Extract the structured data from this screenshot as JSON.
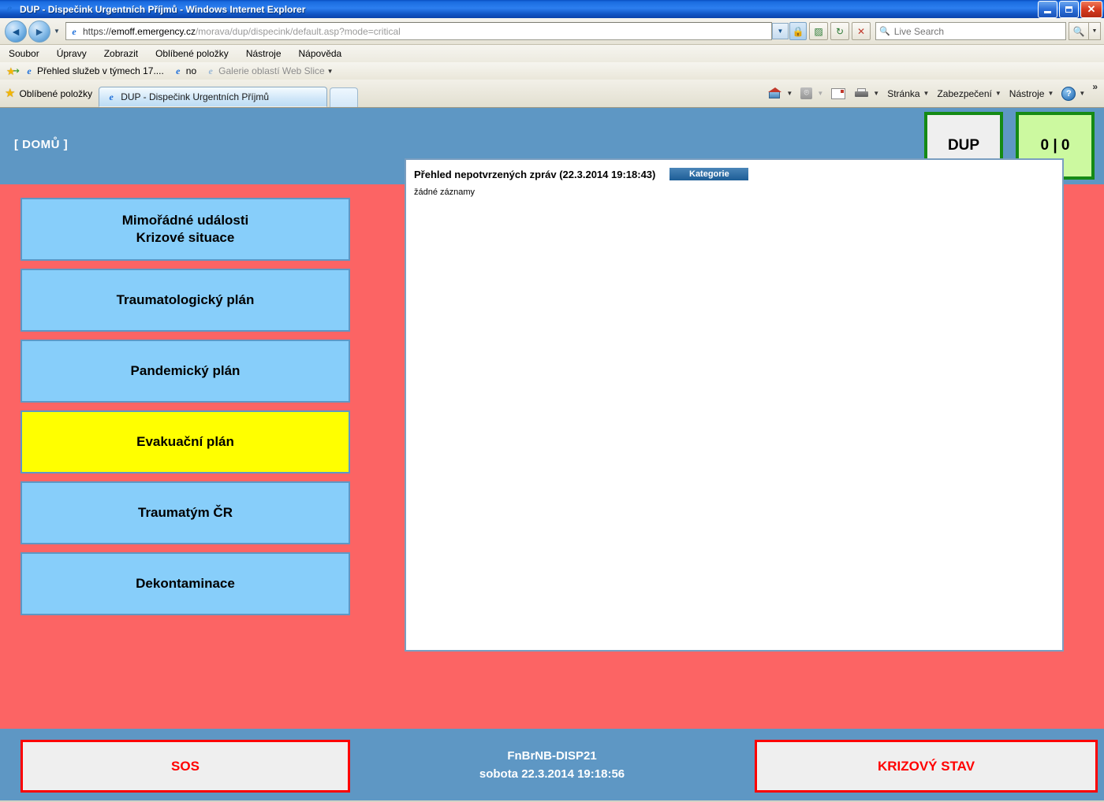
{
  "browser": {
    "title": "DUP - Dispečink Urgentních Příjmů - Windows Internet Explorer",
    "window_controls": {
      "minimize": "–",
      "maximize": "❐",
      "close": "✕"
    },
    "nav": {
      "back": "◄",
      "forward": "►",
      "history_caret": "▼"
    },
    "url": {
      "scheme": "https://",
      "host": "emoff.emergency.cz",
      "path": "/morava/dup/dispecink/default.asp?mode=critical"
    },
    "address_icons": {
      "dropdown": "▼",
      "lock": "🔒",
      "compat": "▨",
      "refresh": "↻",
      "stop": "✕"
    },
    "search": {
      "placeholder": "Live Search",
      "value": "",
      "go": "🔍",
      "caret": "▼"
    },
    "menu": [
      "Soubor",
      "Úpravy",
      "Zobrazit",
      "Oblíbené položky",
      "Nástroje",
      "Nápověda"
    ],
    "links_bar": [
      {
        "label": "Přehled služeb v týmech 17....",
        "dim": false
      },
      {
        "label": "no",
        "dim": false
      },
      {
        "label": "Galerie oblastí Web Slice",
        "dim": true
      }
    ],
    "favorites_button": "Oblíbené položky",
    "tab": {
      "label": "DUP - Dispečink Urgentních Příjmů"
    },
    "command_bar": {
      "home": "",
      "feeds": "",
      "mail": "",
      "print": "",
      "page": "Stránka",
      "safety": "Zabezpečení",
      "tools": "Nástroje",
      "help": "",
      "overflow": "»",
      "caret": "▼"
    }
  },
  "page": {
    "header": {
      "home_link": "[ DOMŮ ]",
      "dup_label": "DUP",
      "counter": "0 | 0"
    },
    "sidebar": [
      {
        "label": "Mimořádné události\nKrizové situace",
        "line1": "Mimořádné události",
        "line2": "Krizové situace",
        "active": false
      },
      {
        "label": "Traumatologický plán",
        "line1": "Traumatologický plán",
        "line2": "",
        "active": false
      },
      {
        "label": "Pandemický plán",
        "line1": "Pandemický plán",
        "line2": "",
        "active": false
      },
      {
        "label": "Evakuační plán",
        "line1": "Evakuační plán",
        "line2": "",
        "active": true
      },
      {
        "label": "Traumatým ČR",
        "line1": "Traumatým ČR",
        "line2": "",
        "active": false
      },
      {
        "label": "Dekontaminace",
        "line1": "Dekontaminace",
        "line2": "",
        "active": false
      }
    ],
    "panel": {
      "title": "Přehled nepotvrzených zpráv (22.3.2014 19:18:43)",
      "category_button": "Kategorie",
      "empty_text": "žádné záznamy"
    },
    "footer": {
      "sos": "SOS",
      "station": "FnBrNB-DISP21",
      "datetime": "sobota  22.3.2014  19:18:56",
      "crisis": "KRIZOVÝ STAV"
    },
    "colors": {
      "background": "#FC6464",
      "header_blue": "#5E97C4",
      "button_blue": "#87CEFA",
      "active_yellow": "#FFFF00",
      "green_border": "#158A15",
      "counter_green": "#CCF9A0",
      "alert_red": "#FF0000"
    }
  }
}
